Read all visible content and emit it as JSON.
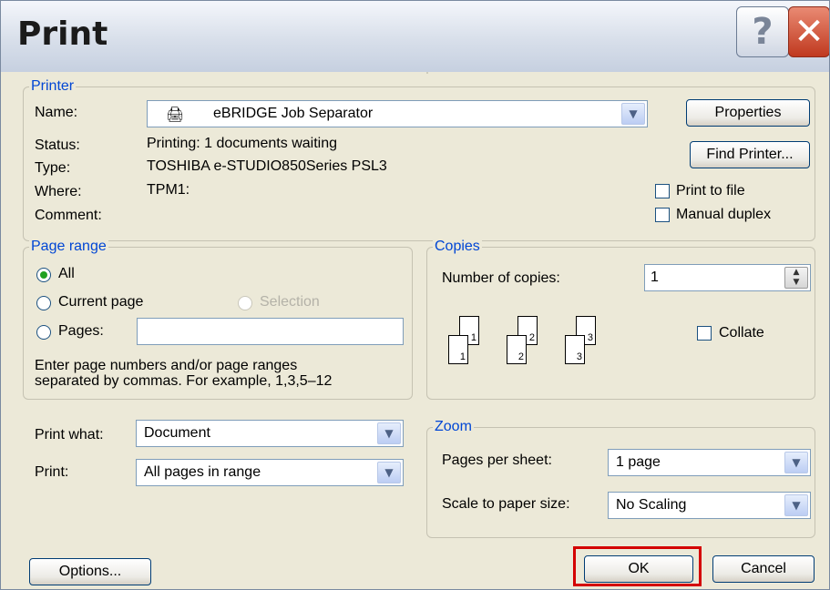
{
  "title": "Print",
  "printer": {
    "group_label": "Printer",
    "name_label": "Name:",
    "name_value": "eBRIDGE Job Separator",
    "status_label": "Status:",
    "status_value": "Printing: 1 documents waiting",
    "type_label": "Type:",
    "type_value": "TOSHIBA e-STUDIO850Series PSL3",
    "where_label": "Where:",
    "where_value": "TPM1:",
    "comment_label": "Comment:",
    "properties_button": "Properties",
    "find_printer_button": "Find Printer...",
    "print_to_file_label": "Print to file",
    "manual_duplex_label": "Manual duplex"
  },
  "page_range": {
    "group_label": "Page range",
    "all_label": "All",
    "current_page_label": "Current page",
    "selection_label": "Selection",
    "pages_label": "Pages:",
    "pages_value": "",
    "selected": "All",
    "hint_line1": "Enter page numbers and/or page ranges",
    "hint_line2": "separated by commas.  For example, 1,3,5–12"
  },
  "copies": {
    "group_label": "Copies",
    "number_label": "Number of copies:",
    "number_value": "1",
    "collate_label": "Collate",
    "collate_pages": [
      "1",
      "1",
      "2",
      "2",
      "3",
      "3"
    ]
  },
  "print_what": {
    "label": "Print what:",
    "value": "Document"
  },
  "print": {
    "label": "Print:",
    "value": "All pages in range"
  },
  "zoom": {
    "group_label": "Zoom",
    "pages_per_sheet_label": "Pages per sheet:",
    "pages_per_sheet_value": "1 page",
    "scale_label": "Scale to paper size:",
    "scale_value": "No Scaling"
  },
  "buttons": {
    "options": "Options...",
    "ok": "OK",
    "cancel": "Cancel"
  },
  "colors": {
    "highlight_box": "#d40000",
    "group_label": "#0046d5"
  }
}
